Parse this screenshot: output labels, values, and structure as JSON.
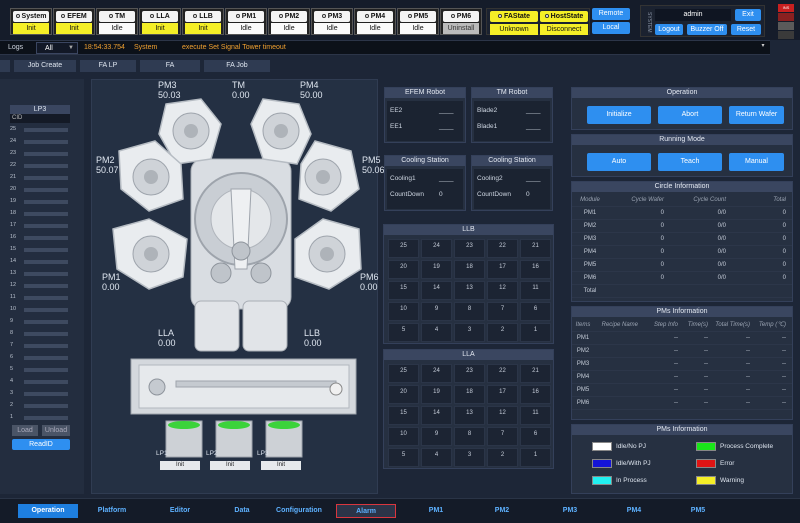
{
  "status": {
    "system": {
      "label": "System",
      "value": "Init"
    },
    "efem": {
      "label": "EFEM",
      "value": "Init"
    },
    "tm": {
      "label": "TM",
      "value": "Idle"
    },
    "lla": {
      "label": "LLA",
      "value": "Init"
    },
    "llb": {
      "label": "LLB",
      "value": "Init"
    },
    "pm1": {
      "label": "PM1",
      "value": "Idle"
    },
    "pm2": {
      "label": "PM2",
      "value": "Idle"
    },
    "pm3": {
      "label": "PM3",
      "value": "Idle"
    },
    "pm4": {
      "label": "PM4",
      "value": "Idle"
    },
    "pm5": {
      "label": "PM5",
      "value": "Idle"
    },
    "pm6": {
      "label": "PM6",
      "value": "Uninstall"
    },
    "fastate": {
      "label": "FAState",
      "value": "Unknown"
    },
    "hoststate": {
      "label": "HostState",
      "value": "Disconnect"
    }
  },
  "controls": {
    "remote": "Remote",
    "local": "Local",
    "system_side": "SYSTEM",
    "user": "admin",
    "exit": "Exit",
    "logout": "Logout",
    "buzzer": "Buzzer Off",
    "reset": "Reset",
    "lamp_top": "INS"
  },
  "log": {
    "label": "Logs",
    "filter": "All",
    "time": "18:54:33.754",
    "source": "System",
    "message": "execute Set Signal Tower timeout"
  },
  "subtabs": [
    "Job Create",
    "FA LP",
    "FA",
    "FA Job"
  ],
  "lp3": {
    "title": "LP3",
    "cid": "CID",
    "slots": [
      "25",
      "24",
      "23",
      "22",
      "21",
      "20",
      "19",
      "18",
      "17",
      "16",
      "15",
      "14",
      "13",
      "12",
      "11",
      "10",
      "9",
      "8",
      "7",
      "6",
      "5",
      "4",
      "3",
      "2",
      "1"
    ],
    "load": "Load",
    "unload": "Unload",
    "readid": "ReadID"
  },
  "chamber": {
    "pm3": {
      "name": "PM3",
      "val": "50.03"
    },
    "tm": {
      "name": "TM",
      "val": "0.00"
    },
    "pm4": {
      "name": "PM4",
      "val": "50.00"
    },
    "pm2": {
      "name": "PM2",
      "val": "50.07"
    },
    "pm5": {
      "name": "PM5",
      "val": "50.06"
    },
    "pm1": {
      "name": "PM1",
      "val": "0.00"
    },
    "pm6": {
      "name": "PM6",
      "val": "0.00"
    },
    "lla": {
      "name": "LLA",
      "val": "0.00"
    },
    "llb": {
      "name": "LLB",
      "val": "0.00"
    },
    "lps": [
      {
        "name": "LP1",
        "state": "Init"
      },
      {
        "name": "LP2",
        "state": "Init"
      },
      {
        "name": "LP3",
        "state": "Init"
      }
    ]
  },
  "robots": {
    "efem": {
      "title": "EFEM Robot",
      "a": "EE2",
      "b": "EE1",
      "va": "____",
      "vb": "____"
    },
    "tm": {
      "title": "TM Robot",
      "a": "Blade2",
      "b": "Blade1",
      "va": "____",
      "vb": "____"
    },
    "cs1": {
      "title": "Cooling Station",
      "a": "Cooling1",
      "b": "CountDown",
      "va": "____",
      "vb": "0"
    },
    "cs2": {
      "title": "Cooling Station",
      "a": "Cooling2",
      "b": "CountDown",
      "va": "____",
      "vb": "0"
    }
  },
  "llb_grid": {
    "title": "LLB",
    "cells": [
      "25",
      "24",
      "23",
      "22",
      "21",
      "20",
      "19",
      "18",
      "17",
      "16",
      "15",
      "14",
      "13",
      "12",
      "11",
      "10",
      "9",
      "8",
      "7",
      "6",
      "5",
      "4",
      "3",
      "2",
      "1"
    ]
  },
  "lla_grid": {
    "title": "LLA",
    "cells": [
      "25",
      "24",
      "23",
      "22",
      "21",
      "20",
      "19",
      "18",
      "17",
      "16",
      "15",
      "14",
      "13",
      "12",
      "11",
      "10",
      "9",
      "8",
      "7",
      "6",
      "5",
      "4",
      "3",
      "2",
      "1"
    ]
  },
  "operation": {
    "title": "Operation",
    "initialize": "Initialize",
    "abort": "Abort",
    "return": "Return Wafer"
  },
  "running": {
    "title": "Running Mode",
    "auto": "Auto",
    "teach": "Teach",
    "manual": "Manual"
  },
  "circle": {
    "title": "Circle Information",
    "headers": [
      "Module",
      "Cycle Wafer",
      "Cycle Count",
      "Total"
    ],
    "rows": [
      [
        "PM1",
        "0",
        "0/0",
        "0"
      ],
      [
        "PM2",
        "0",
        "0/0",
        "0"
      ],
      [
        "PM3",
        "0",
        "0/0",
        "0"
      ],
      [
        "PM4",
        "0",
        "0/0",
        "0"
      ],
      [
        "PM5",
        "0",
        "0/0",
        "0"
      ],
      [
        "PM6",
        "0",
        "0/0",
        "0"
      ],
      [
        "Total",
        "",
        "",
        ""
      ]
    ]
  },
  "pms": {
    "title": "PMs Information",
    "headers": [
      "Items",
      "Recipe Name",
      "Step Info",
      "Time(s)",
      "Total Time(s)",
      "Temp (℃)"
    ],
    "rows": [
      [
        "PM1",
        "",
        "--",
        "--",
        "--",
        "--"
      ],
      [
        "PM2",
        "",
        "--",
        "--",
        "--",
        "--"
      ],
      [
        "PM3",
        "",
        "--",
        "--",
        "--",
        "--"
      ],
      [
        "PM4",
        "",
        "--",
        "--",
        "--",
        "--"
      ],
      [
        "PM5",
        "",
        "--",
        "--",
        "--",
        "--"
      ],
      [
        "PM6",
        "",
        "--",
        "--",
        "--",
        "--"
      ]
    ]
  },
  "legend": {
    "title": "PMs Information",
    "items": [
      {
        "label": "Idle/No PJ",
        "color": "#ffffff"
      },
      {
        "label": "Process Complete",
        "color": "#19e619"
      },
      {
        "label": "Idle/With PJ",
        "color": "#1414d8"
      },
      {
        "label": "Error",
        "color": "#e01414"
      },
      {
        "label": "In Process",
        "color": "#22f0f0"
      },
      {
        "label": "Warning",
        "color": "#f5ef27"
      }
    ]
  },
  "nav": [
    "Operation",
    "Platform",
    "Editor",
    "Data",
    "Configuration",
    "Alarm",
    "PM1",
    "PM2",
    "PM3",
    "PM4",
    "PM5"
  ]
}
